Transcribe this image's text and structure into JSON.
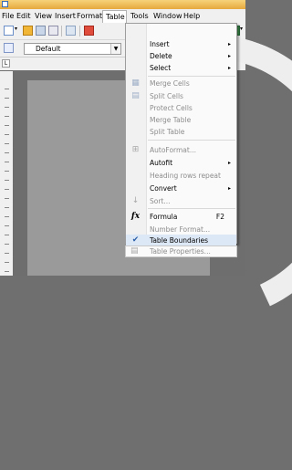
{
  "menubar": {
    "items": [
      "File",
      "Edit",
      "View",
      "Insert",
      "Format",
      "Table",
      "Tools",
      "Window",
      "Help"
    ]
  },
  "toolbar": {
    "paragraph_style": "Default"
  },
  "table_menu": {
    "items": [
      {
        "label": "Insert",
        "submenu": true,
        "enabled": true
      },
      {
        "label": "Delete",
        "submenu": true,
        "enabled": true
      },
      {
        "label": "Select",
        "submenu": true,
        "enabled": true
      },
      {
        "label": "Merge Cells",
        "enabled": false
      },
      {
        "label": "Split Cells",
        "enabled": false
      },
      {
        "label": "Protect Cells",
        "enabled": false
      },
      {
        "label": "Merge Table",
        "enabled": false
      },
      {
        "label": "Split Table",
        "enabled": false
      },
      {
        "label": "AutoFormat...",
        "enabled": false
      },
      {
        "label": "Autofit",
        "submenu": true,
        "enabled": true
      },
      {
        "label": "Heading rows repeat",
        "enabled": false
      },
      {
        "label": "Convert",
        "submenu": true,
        "enabled": true
      },
      {
        "label": "Sort...",
        "enabled": false
      },
      {
        "label": "Formula",
        "shortcut": "F2",
        "enabled": true
      },
      {
        "label": "Number Format...",
        "enabled": false
      },
      {
        "label": "Table Boundaries",
        "enabled": true,
        "checked": true
      },
      {
        "label": "Table Properties...",
        "enabled": false
      }
    ]
  },
  "colors": {
    "menu_bg": "#fafafa",
    "disabled_text": "#8d8d8d",
    "title_bar": "#e6a93c",
    "document_bg": "#6e6e6e"
  }
}
